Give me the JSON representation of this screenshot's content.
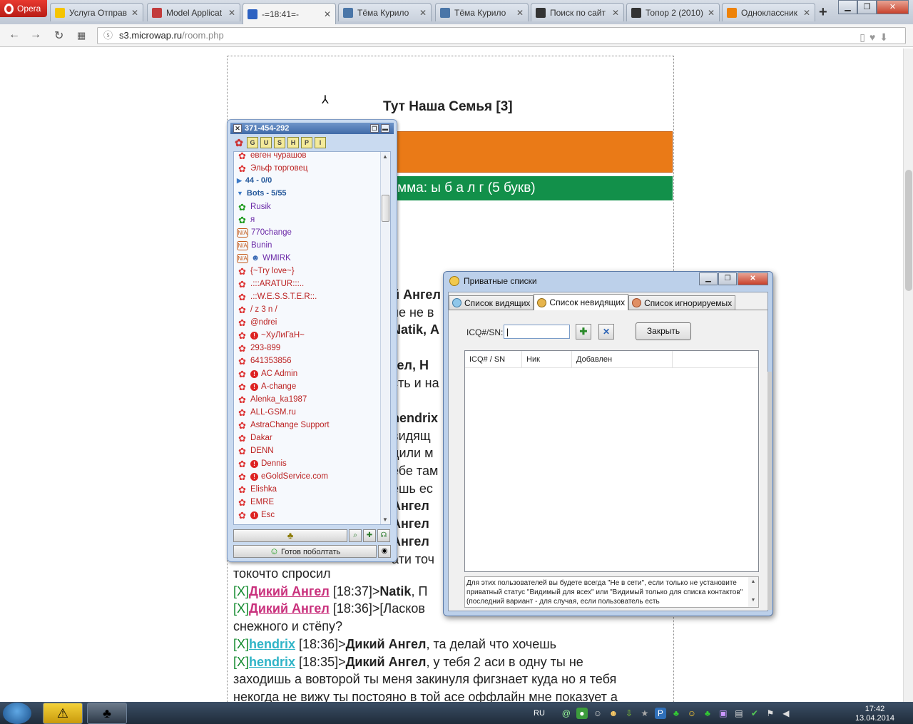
{
  "browser": {
    "brand": "Opera",
    "tabs": [
      {
        "title": "Услуга Отправ",
        "fav_color": "#f5c400"
      },
      {
        "title": "Model Applicat",
        "fav_color": "#c23b3b"
      },
      {
        "title": "-=18:41=-",
        "fav_color": "#2d62c2"
      },
      {
        "title": "Тёма Курило",
        "fav_color": "#4a76a8"
      },
      {
        "title": "Тёма Курило",
        "fav_color": "#4a76a8"
      },
      {
        "title": "Поиск по сайт",
        "fav_color": "#333333"
      },
      {
        "title": "Топор 2 (2010)",
        "fav_color": "#333333"
      },
      {
        "title": "Одноклассник",
        "fav_color": "#ee8208"
      }
    ],
    "url_host": "s3.microwap.ru",
    "url_path": "/room.php"
  },
  "page": {
    "room_title": "Тут Наша Семья [3]",
    "green_bar_text": "мма: ы б а л г (5 букв)",
    "chat_fragments": [
      "й Ангел",
      "не не в",
      "Natik, А",
      "",
      "гел, Н",
      "сть и на",
      "",
      "hendrix",
      "видящ",
      "дили м",
      "ебе там",
      "ешь ес",
      "Ангел",
      "Ангел",
      "Ангел",
      "ати точ"
    ],
    "chat_lines": [
      {
        "text": "токочто спросил"
      },
      {
        "x": "[X]",
        "nick": "Дикий Ангел",
        "nick_style": "red",
        "time": " [18:37]>",
        "rest_bold": "Natik",
        "rest": ", П"
      },
      {
        "x": "[X]",
        "nick": "Дикий Ангел",
        "nick_style": "red",
        "time": " [18:36]>",
        "rest_bold": "",
        "rest": "[Ласков"
      },
      {
        "text": "снежного и стёпу?"
      },
      {
        "x": "[X]",
        "nick": "hendrix",
        "nick_style": "blue",
        "time": " [18:36]>",
        "rest_bold": "Дикий Ангел",
        "rest": ", та делай что хочешь"
      },
      {
        "x": "[X]",
        "nick": "hendrix",
        "nick_style": "blue",
        "time": " [18:35]>",
        "rest_bold": "Дикий Ангел",
        "rest": ", у тебя 2 аси в одну ты не"
      },
      {
        "text": "заходишь а вовторой ты меня закинуля фигзнает куда но я тебя"
      },
      {
        "text": "некогда не вижу ты постояно в той асе оффлайн мне показует а"
      }
    ]
  },
  "qip": {
    "title": "371-454-292",
    "toolbar": [
      "G",
      "U",
      "S",
      "H",
      "P",
      "I"
    ],
    "contacts": [
      {
        "name": "евген чурашов",
        "status": "off",
        "warn": false,
        "style": "red"
      },
      {
        "name": "Эльф торговец",
        "status": "off",
        "warn": false,
        "style": "red"
      },
      {
        "name": "44 - 0/0",
        "group": true,
        "open": false
      },
      {
        "name": "Bots - 5/55",
        "group": true,
        "open": true
      },
      {
        "name": "Rusik",
        "status": "on",
        "warn": false,
        "style": "purple"
      },
      {
        "name": "я",
        "status": "on",
        "warn": false,
        "style": "purple"
      },
      {
        "name": "770change",
        "status": "na",
        "warn": false,
        "style": "purple"
      },
      {
        "name": "Bunin",
        "status": "na",
        "warn": false,
        "style": "purple"
      },
      {
        "name": "WMIRK",
        "status": "na",
        "warn": false,
        "style": "purple",
        "avatar": true
      },
      {
        "name": "{~Try love~}",
        "status": "off",
        "warn": false,
        "style": "red"
      },
      {
        "name": ".:::ARATUR:::..",
        "status": "off",
        "warn": false,
        "style": "red"
      },
      {
        "name": ".::W.E.S.S.T.E.R::.",
        "status": "off",
        "warn": false,
        "style": "red"
      },
      {
        "name": "/ z 3 n /",
        "status": "off",
        "warn": false,
        "style": "red"
      },
      {
        "name": "@ndrei",
        "status": "off",
        "warn": false,
        "style": "red"
      },
      {
        "name": "~ХуЛиГаН~",
        "status": "off",
        "warn": true,
        "style": "red"
      },
      {
        "name": "293-899",
        "status": "off",
        "warn": false,
        "style": "red"
      },
      {
        "name": "641353856",
        "status": "off",
        "warn": false,
        "style": "red"
      },
      {
        "name": "AC Admin",
        "status": "off",
        "warn": true,
        "style": "red"
      },
      {
        "name": "A-change",
        "status": "off",
        "warn": true,
        "style": "red"
      },
      {
        "name": "Alenka_ka1987",
        "status": "off",
        "warn": false,
        "style": "red"
      },
      {
        "name": "ALL-GSM.ru",
        "status": "off",
        "warn": false,
        "style": "red"
      },
      {
        "name": "AstraChange Support",
        "status": "off",
        "warn": false,
        "style": "red"
      },
      {
        "name": "Dakar",
        "status": "off",
        "warn": false,
        "style": "red"
      },
      {
        "name": "DENN",
        "status": "off",
        "warn": false,
        "style": "red"
      },
      {
        "name": "Dennis",
        "status": "off",
        "warn": true,
        "style": "red"
      },
      {
        "name": "eGoldService.com",
        "status": "off",
        "warn": true,
        "style": "red"
      },
      {
        "name": "Elishka",
        "status": "off",
        "warn": false,
        "style": "red"
      },
      {
        "name": "EMRE",
        "status": "off",
        "warn": false,
        "style": "red"
      },
      {
        "name": "Esc",
        "status": "off",
        "warn": true,
        "style": "red"
      }
    ],
    "status_button": "Готов поболтать"
  },
  "dialog": {
    "title": "Приватные списки",
    "tabs": [
      "Список видящих",
      "Список невидящих",
      "Список игнорируемых"
    ],
    "active_tab": 1,
    "icq_label": "ICQ#/SN:",
    "icq_value": "",
    "close_button": "Закрыть",
    "columns": [
      "ICQ# / SN",
      "Ник",
      "Добавлен"
    ],
    "note": "Для этих пользователей вы будете всегда \"Не в сети\", если только не установите приватный статус \"Видимый для всех\" или \"Видимый только для списка контактов\" (последний вариант - для случая, если пользователь есть"
  },
  "taskbar": {
    "lang": "RU",
    "time": "17:42",
    "date": "13.04.2014"
  }
}
